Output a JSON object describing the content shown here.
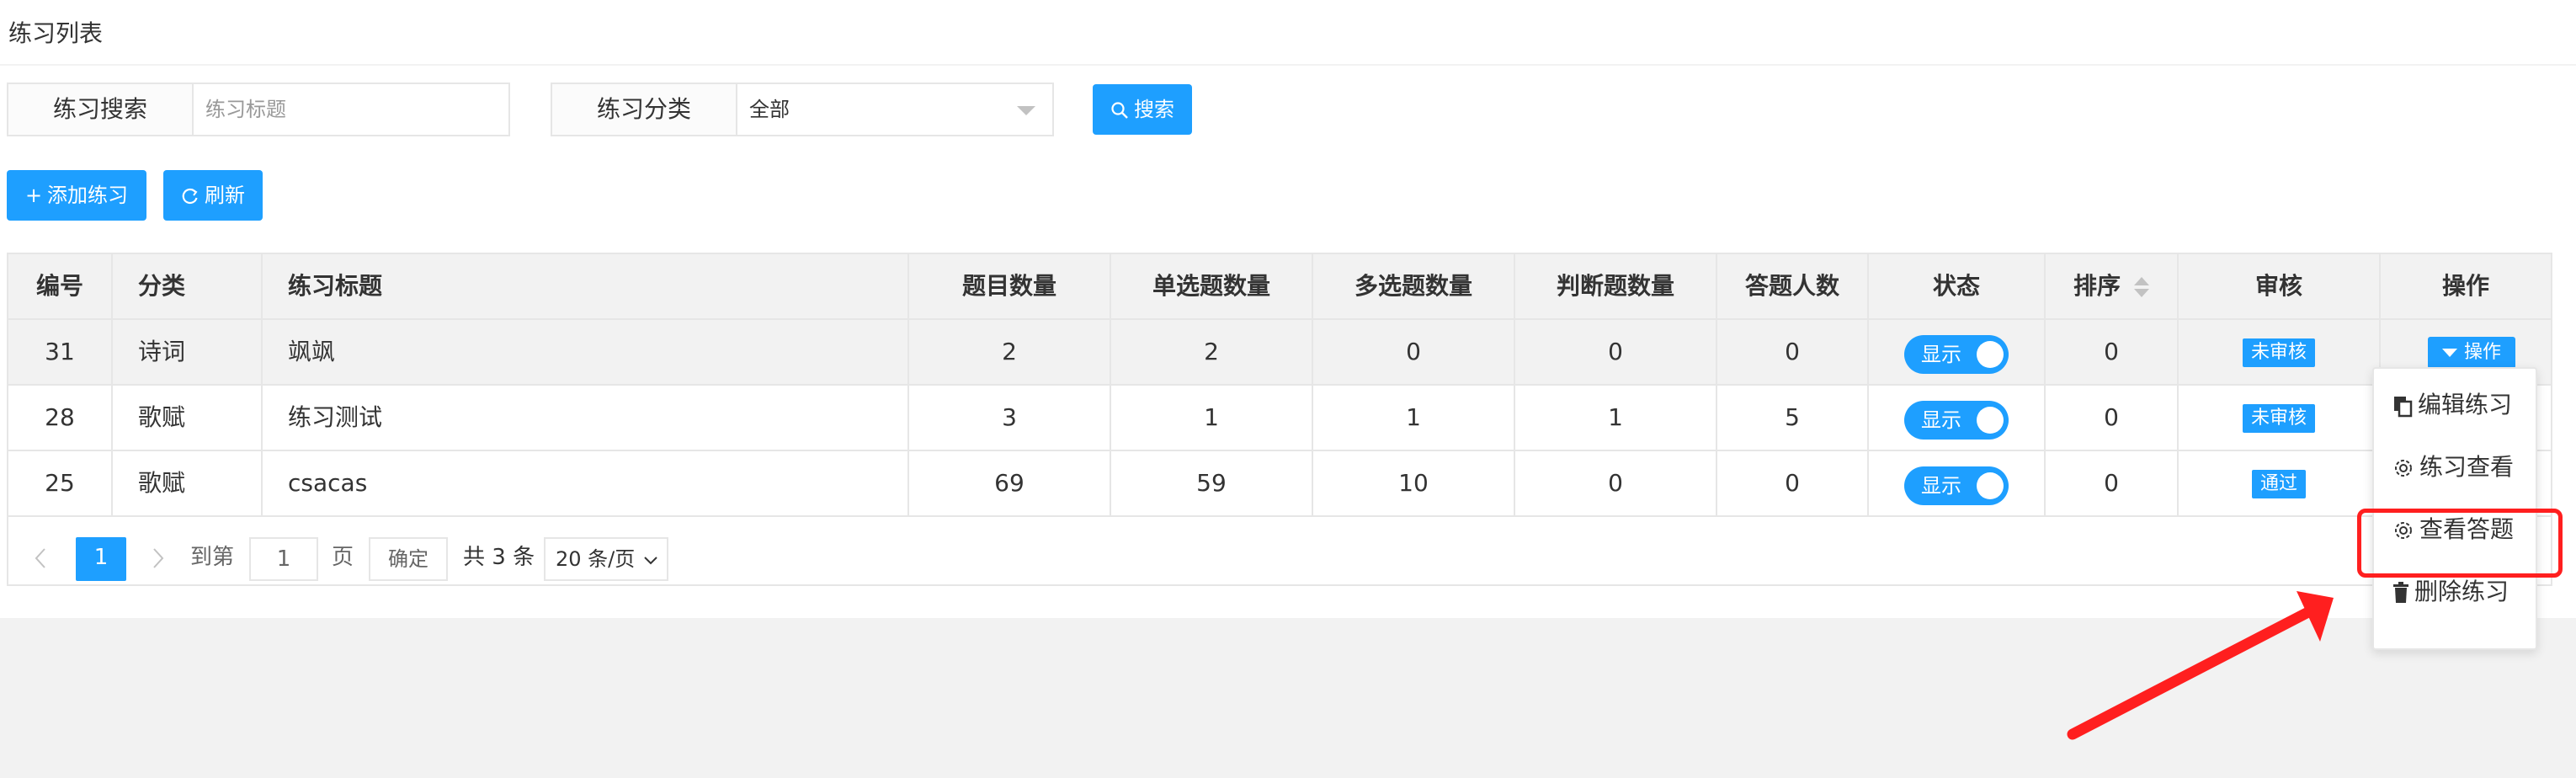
{
  "page_title": "练习列表",
  "search": {
    "keyword_label": "练习搜索",
    "keyword_placeholder": "练习标题",
    "category_label": "练习分类",
    "category_value": "全部",
    "search_button": "搜索"
  },
  "toolbar": {
    "add_button": "添加练习",
    "refresh_button": "刷新"
  },
  "table": {
    "headers": [
      "编号",
      "分类",
      "练习标题",
      "题目数量",
      "单选题数量",
      "多选题数量",
      "判断题数量",
      "答题人数",
      "状态",
      "排序",
      "审核",
      "操作"
    ],
    "rows": [
      {
        "id": "31",
        "category": "诗词",
        "title": "飒飒",
        "total": "2",
        "single": "2",
        "multi": "0",
        "judge": "0",
        "answered": "0",
        "status": "显示",
        "sort": "0",
        "review": "未审核"
      },
      {
        "id": "28",
        "category": "歌赋",
        "title": "练习测试",
        "total": "3",
        "single": "1",
        "multi": "1",
        "judge": "1",
        "answered": "5",
        "status": "显示",
        "sort": "0",
        "review": "未审核"
      },
      {
        "id": "25",
        "category": "歌赋",
        "title": "csacas",
        "total": "69",
        "single": "59",
        "multi": "10",
        "judge": "0",
        "answered": "0",
        "status": "显示",
        "sort": "0",
        "review": "通过"
      }
    ],
    "op_button": "操作"
  },
  "pagination": {
    "current_page": "1",
    "goto_label": "到第",
    "goto_value": "1",
    "page_unit": "页",
    "confirm": "确定",
    "total": "共 3 条",
    "page_size": "20 条/页"
  },
  "dropdown_menu": {
    "items": [
      "编辑练习",
      "练习查看",
      "查看答题",
      "删除练习"
    ]
  },
  "colors": {
    "primary": "#1e9fff",
    "annotation": "#ff1f1f"
  }
}
